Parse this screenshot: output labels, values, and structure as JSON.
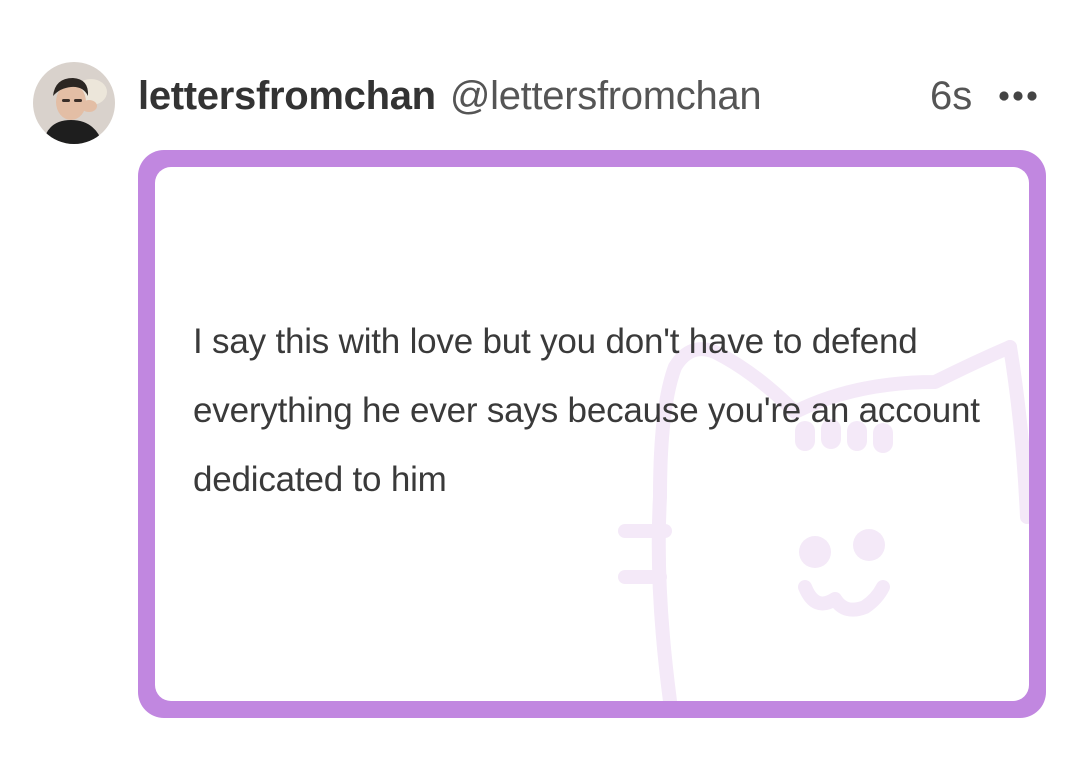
{
  "post": {
    "display_name": "lettersfromchan",
    "handle": "@lettersfromchan",
    "timestamp": "6s",
    "more_icon": "more-horizontal-icon",
    "avatar_icon": "profile-photo"
  },
  "card": {
    "message": "I say this with love but you don't have to defend everything he ever says because you're an account dedicated to him",
    "watermark_icon": "cat-face-icon"
  },
  "colors": {
    "card_border": "#c187e0",
    "watermark": "#f4e9f8",
    "name_text": "#333333",
    "handle_text": "#555555",
    "message_text": "#3a3a3a"
  }
}
